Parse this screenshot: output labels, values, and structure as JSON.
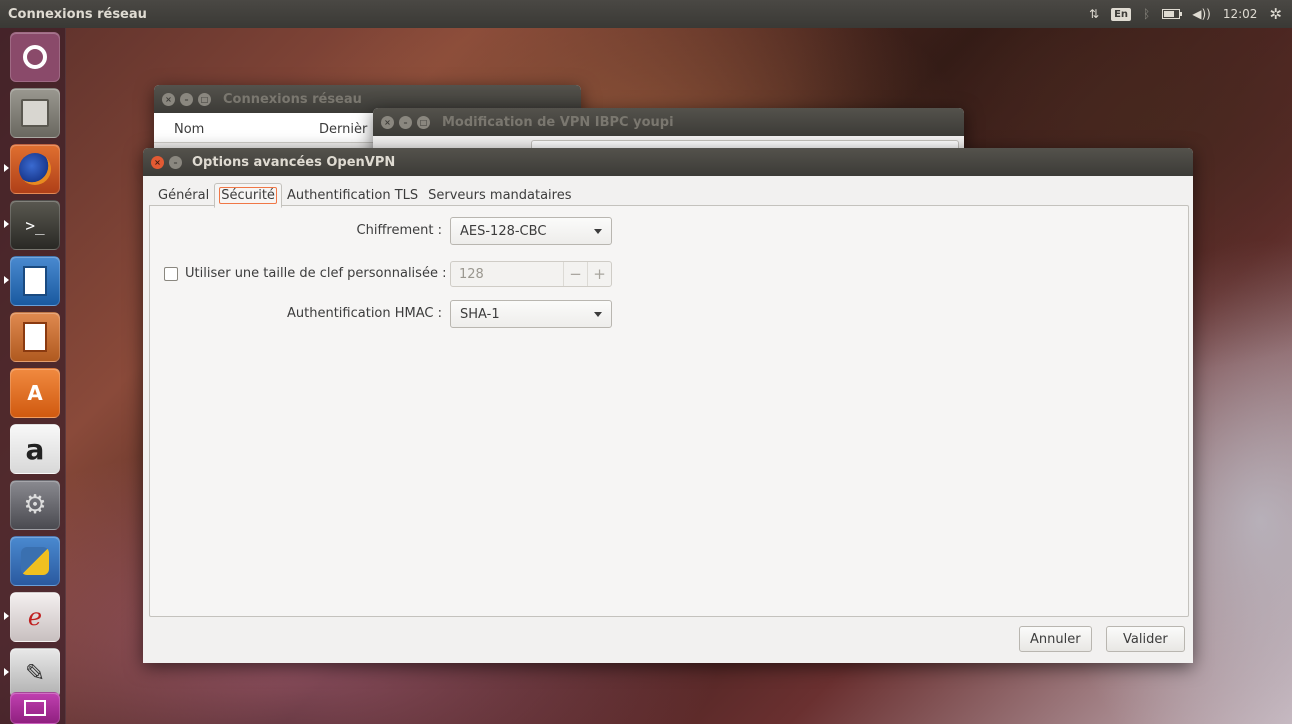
{
  "top_panel": {
    "title": "Connexions réseau",
    "network_icon": "network-arrows-icon",
    "keyboard_layout": "En",
    "bluetooth_icon": "bluetooth-icon",
    "battery_icon": "battery-icon",
    "volume_icon": "volume-icon",
    "clock": "12:02",
    "session_icon": "gear-icon"
  },
  "launcher": {
    "items": [
      {
        "name": "dash-home"
      },
      {
        "name": "files"
      },
      {
        "name": "firefox"
      },
      {
        "name": "terminal"
      },
      {
        "name": "libreoffice-writer"
      },
      {
        "name": "libreoffice-impress"
      },
      {
        "name": "software-center"
      },
      {
        "name": "amazon",
        "label": "a"
      },
      {
        "name": "system-settings"
      },
      {
        "name": "python"
      },
      {
        "name": "pdf-viewer"
      },
      {
        "name": "text-editor"
      },
      {
        "name": "workspace-switcher"
      }
    ]
  },
  "windows": {
    "connections": {
      "title": "Connexions réseau",
      "columns": [
        "Nom",
        "Dernièr"
      ]
    },
    "vpn_edit": {
      "title": "Modification de VPN IBPC youpi"
    },
    "advanced": {
      "title": "Options avancées OpenVPN",
      "tabs": [
        "Général",
        "Sécurité",
        "Authentification TLS",
        "Serveurs mandataires"
      ],
      "active_tab": "Sécurité",
      "cipher_label": "Chiffrement :",
      "cipher_value": "AES-128-CBC",
      "keysize_label": "Utiliser une taille de clef personnalisée :",
      "keysize_checked": false,
      "keysize_value": "128",
      "minus": "−",
      "plus": "+",
      "hmac_label": "Authentification HMAC :",
      "hmac_value": "SHA-1",
      "cancel_label": "Annuler",
      "ok_label": "Valider"
    }
  }
}
